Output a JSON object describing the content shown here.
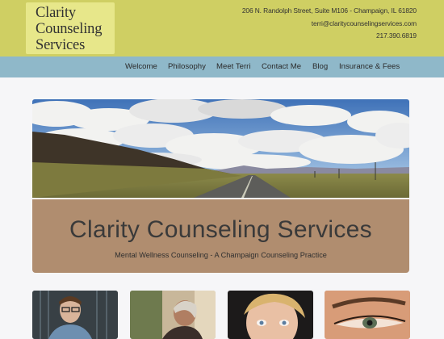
{
  "header": {
    "logo_lines": [
      "Clarity",
      "Counseling",
      "Services"
    ],
    "address": "206 N. Randolph Street, Suite M106 - Champaign, IL 61820",
    "email": "terri@claritycounselingservices.com",
    "phone": "217.390.6819"
  },
  "nav": {
    "items": [
      {
        "label": "Welcome"
      },
      {
        "label": "Philosophy"
      },
      {
        "label": "Meet Terri"
      },
      {
        "label": "Contact Me"
      },
      {
        "label": "Blog"
      },
      {
        "label": "Insurance & Fees"
      }
    ]
  },
  "hero": {
    "image": "road-landscape-with-clouds"
  },
  "title_panel": {
    "title": "Clarity Counseling Services",
    "tagline": "Mental Wellness Counseling - A Champaign Counseling Practice"
  },
  "thumbnails": [
    {
      "image": "man-with-glasses-photo"
    },
    {
      "image": "older-woman-photo"
    },
    {
      "image": "child-face-photo"
    },
    {
      "image": "eye-closeup-photo"
    }
  ],
  "colors": {
    "header_bg": "#cfcf63",
    "logo_bg": "#e7e78a",
    "nav_bg": "#8fb8c9",
    "title_panel_bg": "#b08d6f",
    "page_bg": "#f6f6f8"
  }
}
